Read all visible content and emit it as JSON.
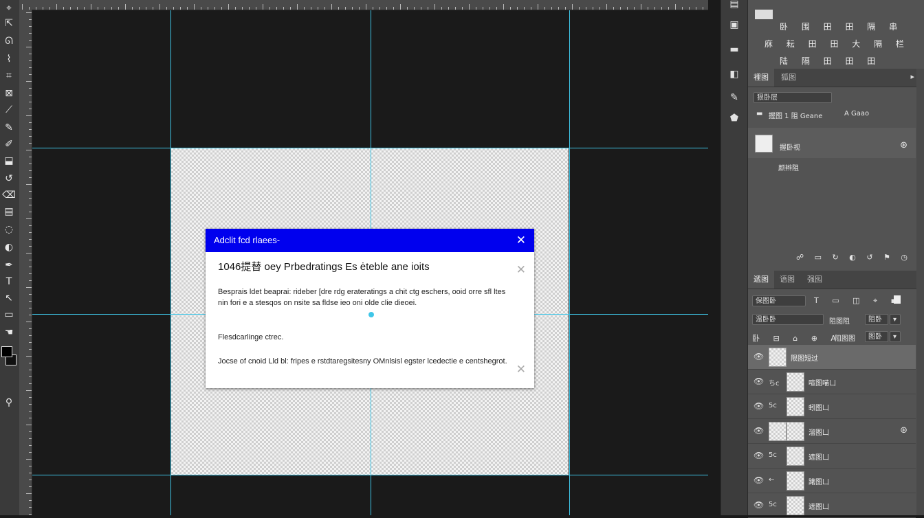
{
  "toolbar": {
    "tools": [
      {
        "name": "move-tool-icon",
        "glyph": "⌖"
      },
      {
        "name": "artboard-tool-icon",
        "glyph": "⇱"
      },
      {
        "name": "lasso-tool-icon",
        "glyph": "ᘏ"
      },
      {
        "name": "quick-select-tool-icon",
        "glyph": "⌇"
      },
      {
        "name": "crop-tool-icon",
        "glyph": "⌗"
      },
      {
        "name": "frame-tool-icon",
        "glyph": "⊠"
      },
      {
        "name": "eyedropper-tool-icon",
        "glyph": "⟋"
      },
      {
        "name": "healing-brush-icon",
        "glyph": "✎"
      },
      {
        "name": "brush-tool-icon",
        "glyph": "✐"
      },
      {
        "name": "stamp-tool-icon",
        "glyph": "⬓"
      },
      {
        "name": "history-brush-icon",
        "glyph": "↺"
      },
      {
        "name": "eraser-tool-icon",
        "glyph": "⌫"
      },
      {
        "name": "gradient-tool-icon",
        "glyph": "▤"
      },
      {
        "name": "blur-tool-icon",
        "glyph": "◌"
      },
      {
        "name": "dodge-tool-icon",
        "glyph": "◐"
      },
      {
        "name": "pen-tool-icon",
        "glyph": "✒"
      },
      {
        "name": "type-tool-icon",
        "glyph": "T"
      },
      {
        "name": "path-select-tool-icon",
        "glyph": "↖"
      },
      {
        "name": "shape-tool-icon",
        "glyph": "▭"
      },
      {
        "name": "hand-tool-icon",
        "glyph": "☚"
      },
      {
        "name": "zoom-tool-icon",
        "glyph": "⚲"
      }
    ],
    "foreground_color": "#000000",
    "background_color": "#111111"
  },
  "canvas": {
    "guide_color": "#3fc6e8",
    "dialog": {
      "title": "Adclit fcd rlaees-",
      "title_bar_color": "#0000ee",
      "heading": "1046提替 oey  Prbedratings Es ėteble ane ioits",
      "paragraph_1": "Besprais ldet beaprai: rideber [dre rdg erateratings a chit ctg eschers, ooid orre sfl ltes nin fori e a stesqos on nsite sa fldse ieo oni olde clie dieoei.",
      "paragraph_2": "Flesdcarlinge ctrec.",
      "paragraph_3": "Jocse of cnoid Lld bl: fripes e rstdtaregsitesny OMnlsisl egster lcedectie e centshegrot."
    }
  },
  "dock": {
    "icons": [
      "history-icon",
      "properties-icon",
      "libraries-icon",
      "adjustments-icon",
      "brush-settings-icon",
      "swatches-icon"
    ]
  },
  "top_panel": {
    "icon_rows": [
      "卧 围 田 田 隔 串",
      "庥 耘 田 田 大 隔 栏",
      "陆 隔 田 田 田"
    ]
  },
  "properties_panel": {
    "tabs": [
      "裡图",
      "狐图"
    ],
    "dropdown_value": "狠卧层",
    "row_text": "握图 1 阻 Geane",
    "row_text_2": "A Gaao",
    "item_name": "握卧视",
    "item_sub": "颜辫阻",
    "bottom_icons": "☍ ▭ ↻ ◐ ↺ ⚑ ◷"
  },
  "layers_panel": {
    "tabs": [
      "遞图",
      "语图",
      "强囮"
    ],
    "kind_filter": "保图卧",
    "blend_mode": "温卧卧",
    "opacity_label": "阻图阻",
    "opacity_value": "阻卧",
    "lock_label": "阻图图",
    "fill_value": "图卧",
    "filter_icons": "T ▭ ◫ ⌖ ▪",
    "lock_icons": "卧 ⊟ ⌂ ⊕ A",
    "layers": [
      {
        "prefix": "",
        "name": "限图短过",
        "selected": true,
        "fx": false
      },
      {
        "prefix": "ちc",
        "name": "喧图喵凵",
        "selected": false,
        "fx": false
      },
      {
        "prefix": "5c",
        "name": "蚓图凵",
        "selected": false,
        "fx": false
      },
      {
        "prefix": "",
        "name": "溜图凵",
        "selected": false,
        "fx": true
      },
      {
        "prefix": "5c",
        "name": "遮图凵",
        "selected": false,
        "fx": false
      },
      {
        "prefix": "←",
        "name": "躇图凵",
        "selected": false,
        "fx": false
      },
      {
        "prefix": "5c",
        "name": "遮图凵",
        "selected": false,
        "fx": false
      }
    ]
  }
}
